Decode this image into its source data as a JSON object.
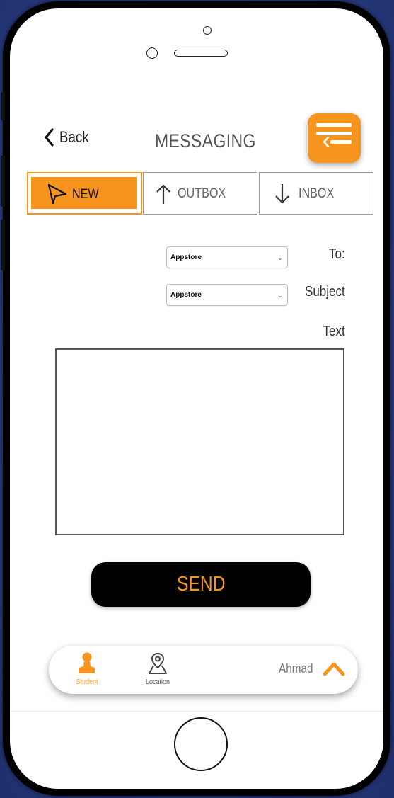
{
  "header": {
    "back_label": "Back",
    "title": "MESSAGING",
    "menu_icon": "menu-lines-icon"
  },
  "tabs": [
    {
      "label": "NEW",
      "icon": "paper-plane-icon",
      "active": true
    },
    {
      "label": "OUTBOX",
      "icon": "arrow-up-icon",
      "active": false
    },
    {
      "label": "INBOX",
      "icon": "arrow-down-icon",
      "active": false
    }
  ],
  "form": {
    "to_label": "To:",
    "to_value": "Appstore",
    "subject_label": "Subject",
    "subject_value": "Appstore",
    "text_label": "Text",
    "text_value": ""
  },
  "send_label": "SEND",
  "bottom_bar": {
    "student_label": "Student",
    "location_label": "Location",
    "user_name": "Ahmad"
  },
  "colors": {
    "accent": "#f7941d",
    "background": "#2b3f86",
    "phone_frame": "#000000"
  }
}
